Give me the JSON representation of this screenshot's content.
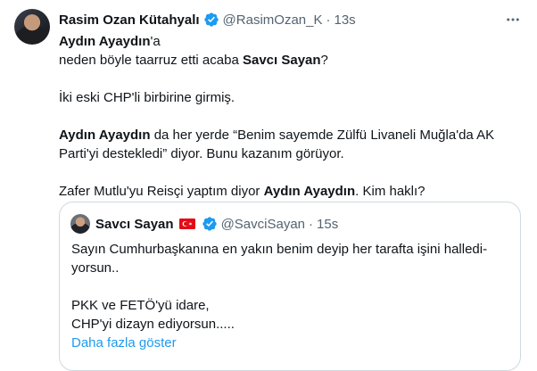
{
  "tweet": {
    "author_name": "Rasim Ozan Kütahyalı",
    "author_handle": "@RasimOzan_K",
    "separator": "·",
    "time": "13s",
    "body": {
      "p1_a": "Aydın Ayaydın",
      "p1_b": "'a",
      "p1_c": "neden böyle taarruz etti acaba ",
      "p1_d": "Savcı Sayan",
      "p1_e": "?",
      "p2": "İki eski CHP'li birbirine girmiş.",
      "p3_a": "Aydın Ayaydın",
      "p3_b": " da her yerde “Benim sayemde Zülfü Livaneli Muğla'da AK Parti'yi destekledi” diyor. Bunu kazanım görüyor.",
      "p4_a": "Zafer Mutlu'yu Reisçi yaptım diyor ",
      "p4_b": "Aydın Ayaydın",
      "p4_c": ". Kim haklı?"
    }
  },
  "quote": {
    "author_name": "Savcı Sayan",
    "author_handle": "@SavciSayan",
    "separator": "·",
    "time": "15s",
    "line1": "Sayın Cumhurbaşkanına en yakın benim deyip her tarafta işini halledi­yorsun..",
    "line2": "PKK ve FETÖ'yü idare,",
    "line3": "CHP'yi dizayn ediyorsun.....",
    "show_more": "Daha fazla göster"
  },
  "colors": {
    "verified": "#1d9bf0",
    "link": "#1d9bf0",
    "muted": "#536471",
    "flag_red": "#e30a17"
  },
  "icons": [
    "verified-badge-icon",
    "more-options-icon",
    "turkey-flag-icon"
  ]
}
